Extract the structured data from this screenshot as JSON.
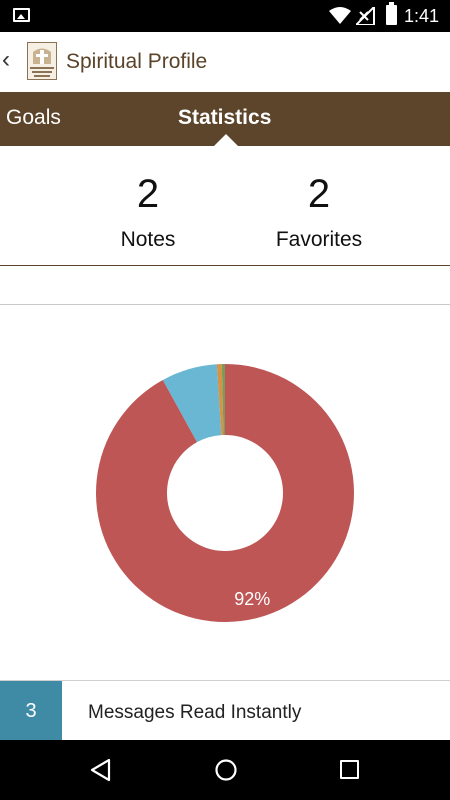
{
  "status_bar": {
    "time": "1:41",
    "icons": [
      "image-icon",
      "wifi-icon",
      "signal-icon",
      "battery-icon"
    ]
  },
  "app_bar": {
    "back_icon": "‹",
    "title": "Spiritual Profile",
    "logo_text": "STAR OF HOPE"
  },
  "tabs": [
    {
      "label": "Goals",
      "selected": false
    },
    {
      "label": "Statistics",
      "selected": true
    }
  ],
  "counts": {
    "notes": {
      "value": "2",
      "label": "Notes"
    },
    "favorites": {
      "value": "2",
      "label": "Favorites"
    }
  },
  "chart_data": {
    "type": "pie",
    "donut": true,
    "slices": [
      {
        "value": 92,
        "color": "#bf5656",
        "label": "92%"
      },
      {
        "value": 7,
        "color": "#6ab7d3",
        "label": ""
      },
      {
        "value": 0.6,
        "color": "#d69245",
        "label": ""
      },
      {
        "value": 0.4,
        "color": "#7a9c5a",
        "label": ""
      }
    ]
  },
  "stat_row": {
    "badge": "3",
    "badge_color": "#3f8ba6",
    "label": "Messages Read Instantly"
  },
  "colors": {
    "brand_brown": "#5d452b",
    "title_text": "#5a4329"
  },
  "nav_bar": {
    "icons": [
      "back-nav-icon",
      "home-nav-icon",
      "recents-nav-icon"
    ]
  }
}
